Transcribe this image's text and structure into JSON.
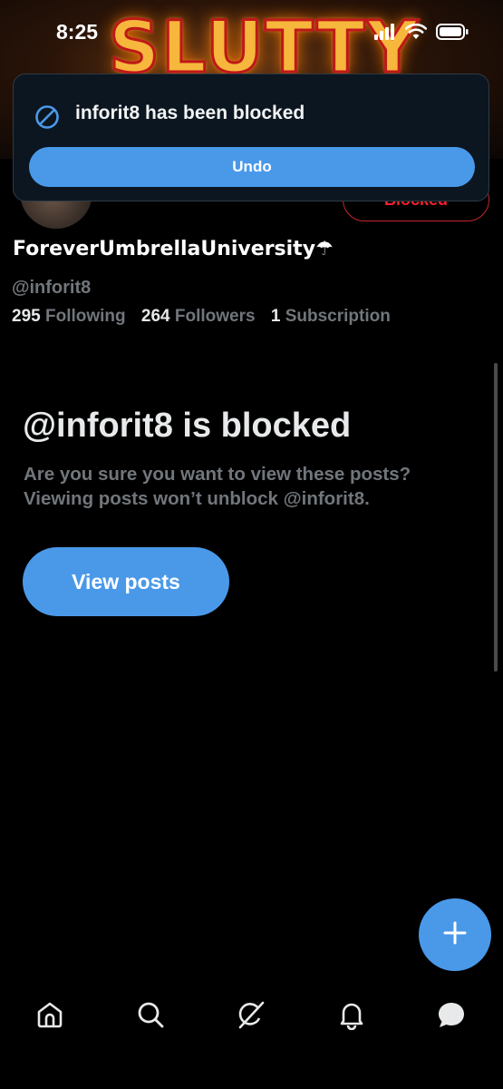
{
  "status_bar": {
    "time": "8:25"
  },
  "banner": {
    "art_text": "SLUTTY"
  },
  "toast": {
    "message": "inforit8 has been blocked",
    "undo_label": "Undo",
    "icon": "block-icon"
  },
  "profile": {
    "display_name": "ForeverUmbrellaUniversity☂",
    "handle": "@inforit8",
    "relationship_button": "Blocked",
    "following_count": "295",
    "following_label": "Following",
    "followers_count": "264",
    "followers_label": "Followers",
    "subscription_count": "1",
    "subscription_label": "Subscription"
  },
  "blocked_notice": {
    "title": "@inforit8 is blocked",
    "description": "Are you sure you want to view these posts? Viewing posts won’t unblock @inforit8.",
    "view_posts_label": "View posts"
  },
  "fab": {
    "icon": "plus-icon"
  },
  "bottom_nav": {
    "items": [
      {
        "icon": "home-icon"
      },
      {
        "icon": "search-icon"
      },
      {
        "icon": "grok-icon"
      },
      {
        "icon": "bell-icon"
      },
      {
        "icon": "messages-icon"
      }
    ]
  },
  "colors": {
    "accent": "#4a99e9",
    "blocked_red": "#f4212e",
    "muted_text": "#71767b",
    "background": "#000000"
  }
}
